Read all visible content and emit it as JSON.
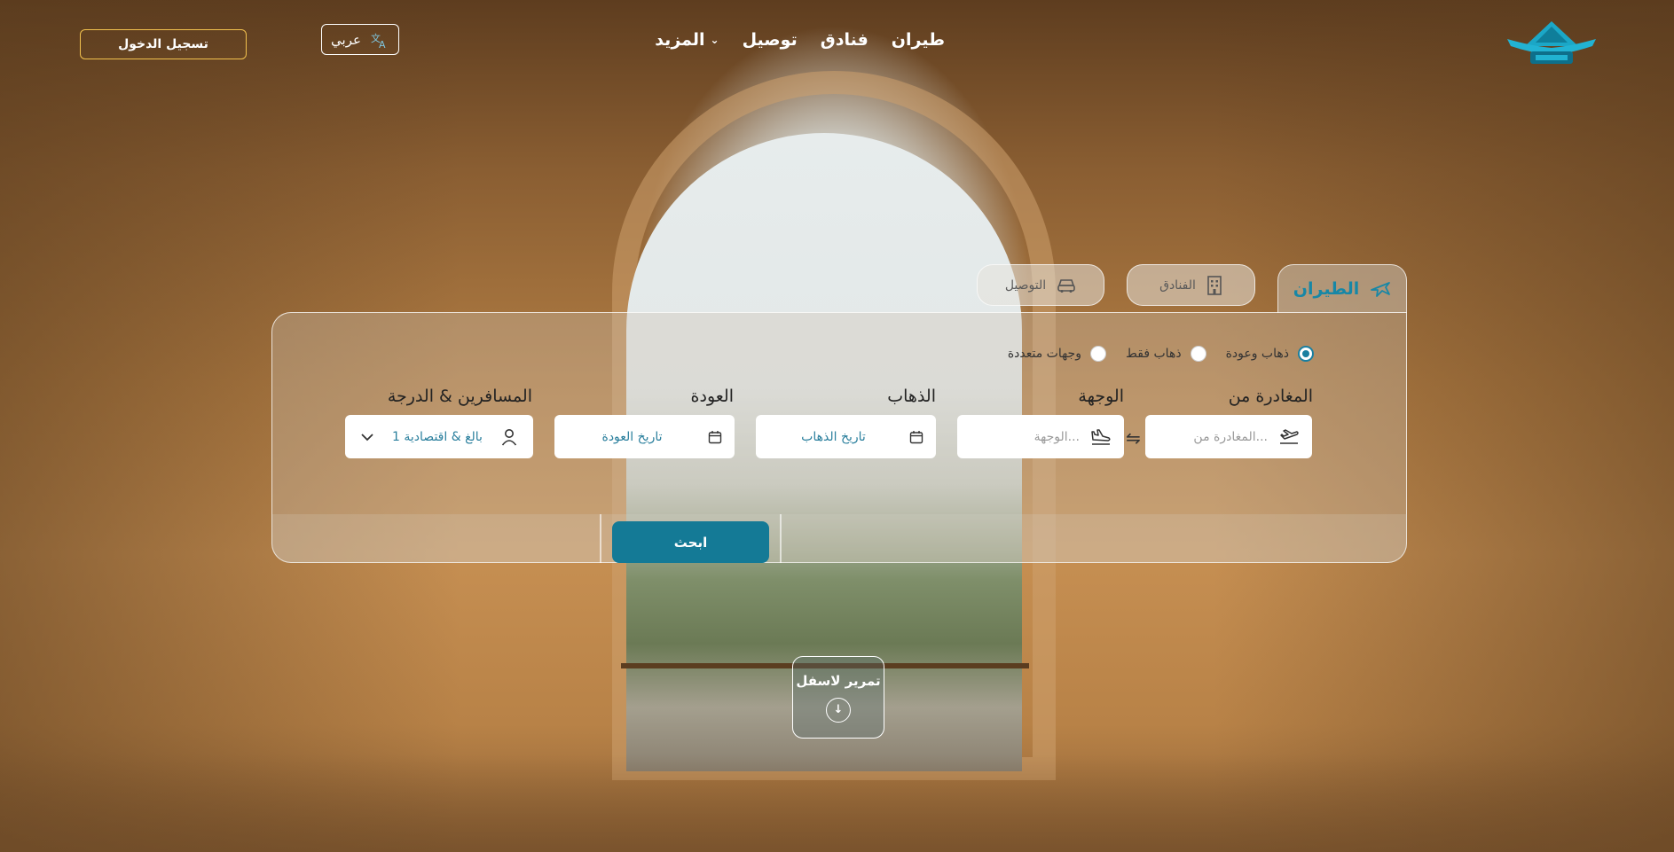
{
  "header": {
    "nav": [
      {
        "label": "طيران"
      },
      {
        "label": "فنادق"
      },
      {
        "label": "توصيل"
      },
      {
        "label": "المزيد"
      }
    ],
    "language_label": "عربي",
    "login_label": "تسجيل الدخول"
  },
  "tabs": [
    {
      "label": "الطيران",
      "icon": "plane-icon",
      "active": true
    },
    {
      "label": "الفنادق",
      "icon": "building-icon",
      "active": false
    },
    {
      "label": "التوصيل",
      "icon": "car-icon",
      "active": false
    }
  ],
  "trip_types": [
    {
      "label": "ذهاب وعودة",
      "checked": true
    },
    {
      "label": "ذهاب فقط",
      "checked": false
    },
    {
      "label": "وجهات متعددة",
      "checked": false
    }
  ],
  "fields": {
    "from": {
      "label": "المغادرة من",
      "placeholder": "المغادرة من..."
    },
    "to": {
      "label": "الوجهة",
      "placeholder": "الوجهة..."
    },
    "depart": {
      "label": "الذهاب",
      "value": "تاريخ الذهاب"
    },
    "return": {
      "label": "العودة",
      "value": "تاريخ العودة"
    },
    "passengers": {
      "label": "المسافرين & الدرجة",
      "value": "1 بالغ & اقتصادية"
    }
  },
  "search_label": "ابحث",
  "scroll_label": "تمرير لاسفل",
  "colors": {
    "accent": "#147a96",
    "login_border": "#f2c14e",
    "active_tab_text": "#1787a6"
  }
}
